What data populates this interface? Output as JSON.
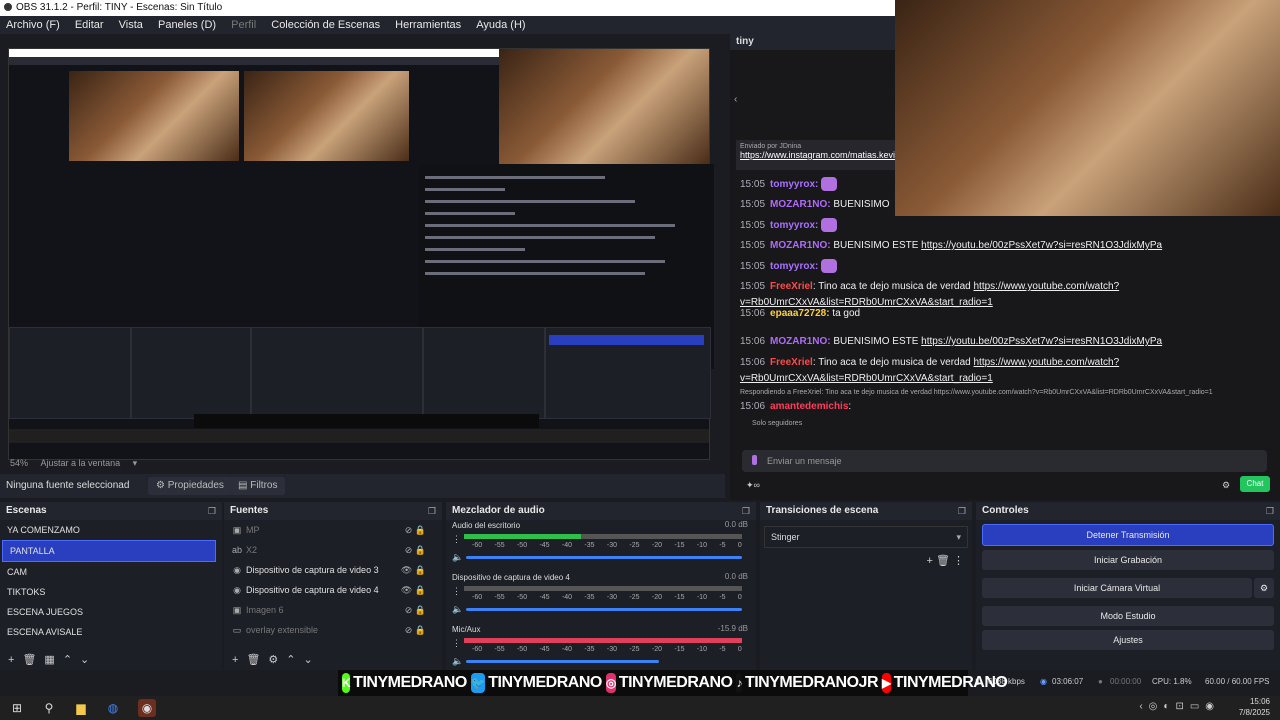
{
  "window": {
    "title": "OBS 31.1.2 - Perfil: TINY - Escenas: Sin Título"
  },
  "menu": [
    {
      "label": "Archivo (F)"
    },
    {
      "label": "Editar"
    },
    {
      "label": "Vista"
    },
    {
      "label": "Paneles (D)"
    },
    {
      "label": "Perfil"
    },
    {
      "label": "Colección de Escenas"
    },
    {
      "label": "Herramientas"
    },
    {
      "label": "Ayuda (H)"
    }
  ],
  "preview": {
    "zoom": "54%",
    "fit_label": "Ajustar a la ventana"
  },
  "source_bar": {
    "none_selected": "Ninguna fuente seleccionad",
    "properties": "Propiedades",
    "filters": "Filtros"
  },
  "chat": {
    "channel": "tiny",
    "pinned_by": "Enviado por",
    "pinned_user": "JDnina",
    "pinned_link": "https://www.instagram.com/matias.kevin0",
    "messages": [
      {
        "time": "15:05",
        "user": "tomyyrox:",
        "color": "#a970ff",
        "text": ""
      },
      {
        "time": "15:05",
        "user": "MOZAR1NO:",
        "color": "#b06cf7",
        "text": " BUENISIMO"
      },
      {
        "time": "15:05",
        "user": "tomyyrox:",
        "color": "#a970ff",
        "text": ""
      },
      {
        "time": "15:05",
        "user": "MOZAR1NO:",
        "color": "#b06cf7",
        "text": " BUENISIMO ESTE ",
        "link": "https://youtu.be/00zPssXet7w?si=resRN1O3JdixMyPa"
      },
      {
        "time": "15:05",
        "user": "tomyyrox:",
        "color": "#a970ff",
        "text": ""
      },
      {
        "time": "15:05",
        "user": "FreeXriel",
        "color": "#ff4a4a",
        "text": ": Tino aca te dejo musica de verdad ",
        "link": "https://www.youtube.com/watch?v=Rb0UmrCXxVA&list=RDRb0UmrCXxVA&start_radio=1"
      },
      {
        "time": "15:06",
        "user": "epaaa72728:",
        "color": "#ffd23a",
        "text": " ta god"
      },
      {
        "time": "15:06",
        "user": "MOZAR1NO:",
        "color": "#b06cf7",
        "text": " BUENISIMO ESTE ",
        "link": "https://youtu.be/00zPssXet7w?si=resRN1O3JdixMyPa"
      },
      {
        "time": "15:06",
        "user": "FreeXriel",
        "color": "#ff4a4a",
        "text": ": Tino aca te dejo musica de verdad ",
        "link": "https://www.youtube.com/watch?v=Rb0UmrCXxVA&list=RDRb0UmrCXxVA&start_radio=1"
      },
      {
        "time": "15:06",
        "user": "amantedemichis",
        "color": "#ff3b5c",
        "text": ":"
      }
    ],
    "reply_note": "Respondiendo a FreeXriel: Tino aca te dejo musica de verdad https://www.youtube.com/watch?v=Rb0UmrCXxVA&list=RDRb0UmrCXxVA&start_radio=1",
    "followers_only": "Solo seguidores",
    "input_placeholder": "Enviar un mensaje",
    "send_label": "Chat"
  },
  "scenes": {
    "title": "Escenas",
    "items": [
      "YA COMENZAMO",
      "PANTALLA",
      "CAM",
      "TIKTOKS",
      "ESCENA JUEGOS",
      "ESCENA AVISALE"
    ],
    "selected_index": 1
  },
  "sources": {
    "title": "Fuentes",
    "items": [
      {
        "label": "MP",
        "visible": false
      },
      {
        "label": "X2",
        "visible": false
      },
      {
        "label": "Dispositivo de captura de video 3",
        "visible": true
      },
      {
        "label": "Dispositivo de captura de video 4",
        "visible": true
      },
      {
        "label": "Imagen 6",
        "visible": false
      },
      {
        "label": "overlay extensible",
        "visible": false
      }
    ]
  },
  "mixer": {
    "title": "Mezclador de audio",
    "scale": [
      "-60",
      "-55",
      "-50",
      "-45",
      "-40",
      "-35",
      "-30",
      "-25",
      "-20",
      "-15",
      "-10",
      "-5",
      "0"
    ],
    "channels": [
      {
        "name": "Audio del escritorio",
        "db": "0.0 dB",
        "level": 0.42,
        "volume": 1.0
      },
      {
        "name": "Dispositivo de captura de video 4",
        "db": "0.0 dB",
        "level": 0.0,
        "volume": 1.0
      },
      {
        "name": "Mic/Aux",
        "db": "-15.9 dB",
        "level": 0.85,
        "volume": 0.7
      }
    ]
  },
  "transitions": {
    "title": "Transiciones de escena",
    "selected": "Stinger"
  },
  "controls": {
    "title": "Controles",
    "buttons": [
      "Detener Transmisión",
      "Iniciar Grabación",
      "Iniciar Cámara Virtual",
      "Modo Estudio",
      "Ajustes"
    ]
  },
  "status": {
    "bitrate": "6088 kbps",
    "stream_time": "03:06:07",
    "rec_time": "00:00:00",
    "cpu": "CPU: 1.8%",
    "fps": "60.00 / 60.00 FPS"
  },
  "social": {
    "handles": [
      {
        "label": "TINYMEDRANO",
        "platform": "kick",
        "color": "#53fc18"
      },
      {
        "label": "TINYMEDRANO",
        "platform": "twitter",
        "color": "#1d9bf0"
      },
      {
        "label": "TINYMEDRANO",
        "platform": "instagram",
        "color": "#e1306c"
      },
      {
        "label": "TINYMEDRANOJR",
        "platform": "tiktok",
        "color": "#111111"
      },
      {
        "label": "TINYMEDRANO",
        "platform": "youtube",
        "color": "#ff0000"
      }
    ]
  },
  "clock": {
    "time": "15:06",
    "date": "7/8/2025"
  }
}
